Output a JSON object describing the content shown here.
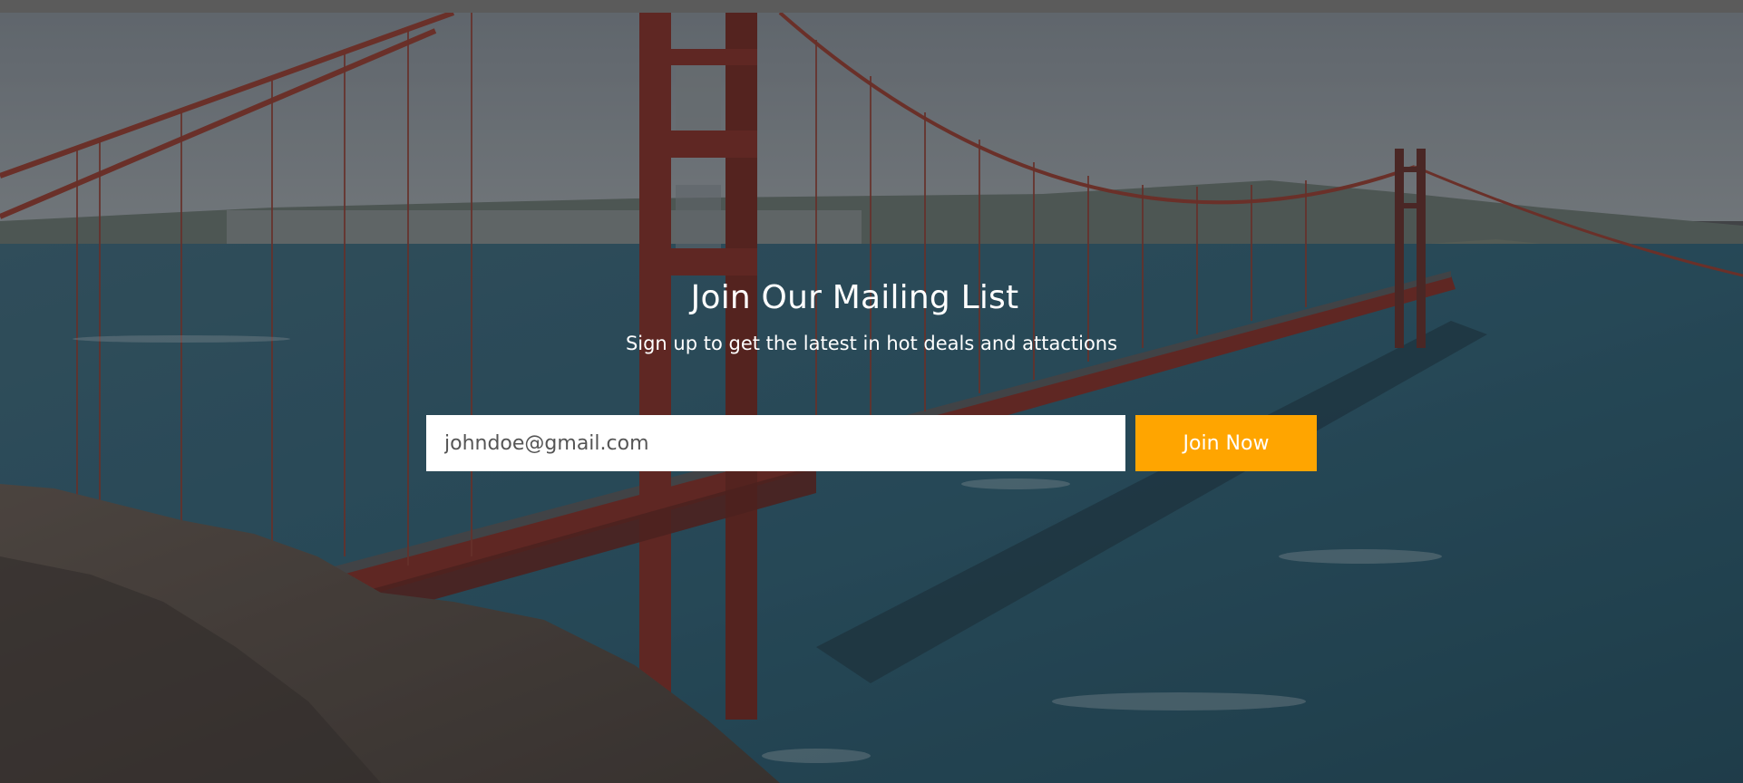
{
  "mailing": {
    "title": "Join Our Mailing List",
    "subtitle": "Sign up to get the latest in hot deals and attactions",
    "email_placeholder": "johndoe@gmail.com",
    "email_value": "",
    "button_label": "Join Now"
  },
  "colors": {
    "button": "#ffa500",
    "overlay": "rgba(30,35,42,0.42)",
    "bridge": "#8e2a1e",
    "water": "#1f4a5a"
  }
}
